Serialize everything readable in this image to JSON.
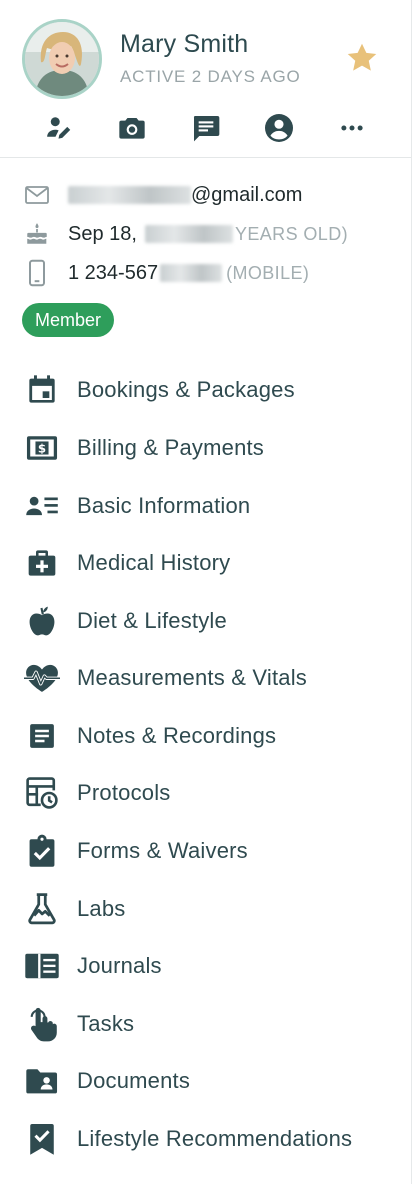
{
  "profile": {
    "name": "Mary Smith",
    "status": "ACTIVE 2 DAYS AGO",
    "favorite": true
  },
  "actions": [
    {
      "icon": "edit-icon"
    },
    {
      "icon": "camera-icon"
    },
    {
      "icon": "message-icon"
    },
    {
      "icon": "account-icon"
    },
    {
      "icon": "more-icon"
    }
  ],
  "contact": {
    "email_suffix": "@gmail.com",
    "birthday_prefix": "Sep 18,",
    "age_suffix": "YEARS OLD)",
    "phone_prefix": "1 234-567",
    "phone_type": "(MOBILE)"
  },
  "badge": "Member",
  "menu": [
    {
      "label": "Bookings & Packages",
      "icon": "calendar-icon"
    },
    {
      "label": "Billing & Payments",
      "icon": "billing-icon"
    },
    {
      "label": "Basic Information",
      "icon": "contact-list-icon"
    },
    {
      "label": "Medical History",
      "icon": "medical-kit-icon"
    },
    {
      "label": "Diet & Lifestyle",
      "icon": "apple-icon"
    },
    {
      "label": "Measurements & Vitals",
      "icon": "heart-pulse-icon"
    },
    {
      "label": "Notes & Recordings",
      "icon": "note-icon"
    },
    {
      "label": "Protocols",
      "icon": "protocol-schedule-icon"
    },
    {
      "label": "Forms & Waivers",
      "icon": "clipboard-check-icon"
    },
    {
      "label": "Labs",
      "icon": "flask-icon"
    },
    {
      "label": "Journals",
      "icon": "journal-icon"
    },
    {
      "label": "Tasks",
      "icon": "task-hand-icon"
    },
    {
      "label": "Documents",
      "icon": "folder-user-icon"
    },
    {
      "label": "Lifestyle Recommendations",
      "icon": "bookmark-check-icon"
    }
  ],
  "colors": {
    "text": "#2f4a4f",
    "muted": "#9aa5a8",
    "badge": "#2e9e5b",
    "star": "#e8c17a",
    "avatar_ring": "#a9d3c7"
  }
}
